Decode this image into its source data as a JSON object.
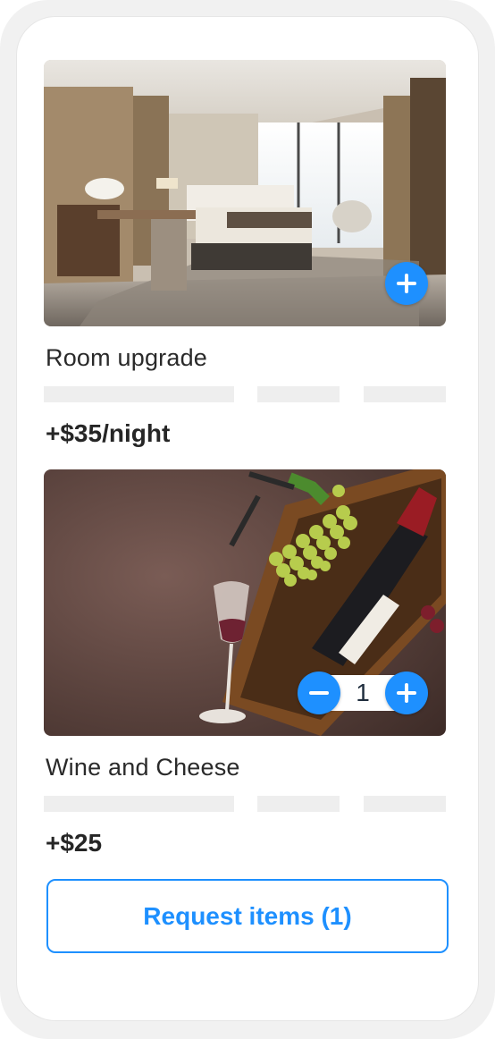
{
  "items": [
    {
      "title": "Room upgrade",
      "price": "+$35/night",
      "action": {
        "icon": "plus-icon"
      }
    },
    {
      "title": "Wine and Cheese",
      "price": "+$25",
      "quantity": "1",
      "action": {
        "decrement_icon": "minus-icon",
        "increment_icon": "plus-icon"
      }
    }
  ],
  "request_button": {
    "label": "Request items (1)"
  },
  "colors": {
    "accent": "#1e90ff",
    "text": "#2a2a2a",
    "skeleton": "#eeeeee"
  }
}
